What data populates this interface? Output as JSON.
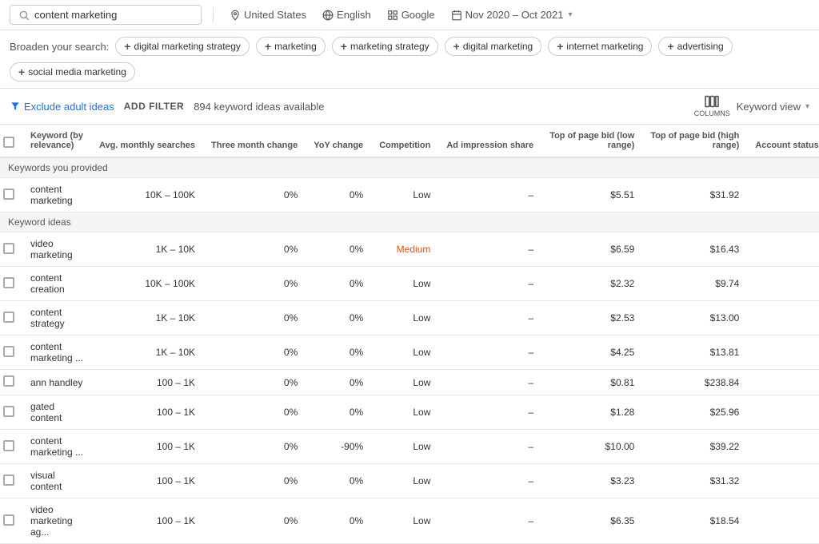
{
  "topbar": {
    "search_value": "content marketing",
    "search_placeholder": "content marketing",
    "location": "United States",
    "language": "English",
    "network": "Google",
    "date_range": "Nov 2020 – Oct 2021"
  },
  "broaden": {
    "label": "Broaden your search:",
    "chips": [
      "digital marketing strategy",
      "marketing",
      "marketing strategy",
      "digital marketing",
      "internet marketing",
      "advertising",
      "social media marketing"
    ]
  },
  "filter_bar": {
    "exclude_label": "Exclude adult ideas",
    "add_filter": "ADD FILTER",
    "keyword_count": "894 keyword ideas available",
    "columns_label": "COLUMNS",
    "keyword_view": "Keyword view"
  },
  "table": {
    "columns": [
      "",
      "Keyword (by relevance)",
      "Avg. monthly searches",
      "Three month change",
      "YoY change",
      "Competition",
      "Ad impression share",
      "Top of page bid (low range)",
      "Top of page bid (high range)",
      "Account status"
    ],
    "sections": [
      {
        "type": "header",
        "label": "Keywords you provided"
      },
      {
        "type": "row",
        "keyword": "content marketing",
        "avg_monthly": "10K – 100K",
        "three_month": "0%",
        "yoy": "0%",
        "competition": "Low",
        "ad_impression": "–",
        "bid_low": "$5.51",
        "bid_high": "$31.92",
        "account_status": ""
      },
      {
        "type": "header",
        "label": "Keyword ideas"
      },
      {
        "type": "row",
        "keyword": "video marketing",
        "avg_monthly": "1K – 10K",
        "three_month": "0%",
        "yoy": "0%",
        "competition": "Medium",
        "ad_impression": "–",
        "bid_low": "$6.59",
        "bid_high": "$16.43",
        "account_status": ""
      },
      {
        "type": "row",
        "keyword": "content creation",
        "avg_monthly": "10K – 100K",
        "three_month": "0%",
        "yoy": "0%",
        "competition": "Low",
        "ad_impression": "–",
        "bid_low": "$2.32",
        "bid_high": "$9.74",
        "account_status": ""
      },
      {
        "type": "row",
        "keyword": "content strategy",
        "avg_monthly": "1K – 10K",
        "three_month": "0%",
        "yoy": "0%",
        "competition": "Low",
        "ad_impression": "–",
        "bid_low": "$2.53",
        "bid_high": "$13.00",
        "account_status": ""
      },
      {
        "type": "row",
        "keyword": "content marketing ...",
        "avg_monthly": "1K – 10K",
        "three_month": "0%",
        "yoy": "0%",
        "competition": "Low",
        "ad_impression": "–",
        "bid_low": "$4.25",
        "bid_high": "$13.81",
        "account_status": ""
      },
      {
        "type": "row",
        "keyword": "ann handley",
        "avg_monthly": "100 – 1K",
        "three_month": "0%",
        "yoy": "0%",
        "competition": "Low",
        "ad_impression": "–",
        "bid_low": "$0.81",
        "bid_high": "$238.84",
        "account_status": ""
      },
      {
        "type": "row",
        "keyword": "gated content",
        "avg_monthly": "100 – 1K",
        "three_month": "0%",
        "yoy": "0%",
        "competition": "Low",
        "ad_impression": "–",
        "bid_low": "$1.28",
        "bid_high": "$25.96",
        "account_status": ""
      },
      {
        "type": "row",
        "keyword": "content marketing ...",
        "avg_monthly": "100 – 1K",
        "three_month": "0%",
        "yoy": "-90%",
        "competition": "Low",
        "ad_impression": "–",
        "bid_low": "$10.00",
        "bid_high": "$39.22",
        "account_status": ""
      },
      {
        "type": "row",
        "keyword": "visual content",
        "avg_monthly": "100 – 1K",
        "three_month": "0%",
        "yoy": "0%",
        "competition": "Low",
        "ad_impression": "–",
        "bid_low": "$3.23",
        "bid_high": "$31.32",
        "account_status": ""
      },
      {
        "type": "row",
        "keyword": "video marketing ag...",
        "avg_monthly": "100 – 1K",
        "three_month": "0%",
        "yoy": "0%",
        "competition": "Low",
        "ad_impression": "–",
        "bid_low": "$6.35",
        "bid_high": "$18.54",
        "account_status": ""
      }
    ]
  }
}
